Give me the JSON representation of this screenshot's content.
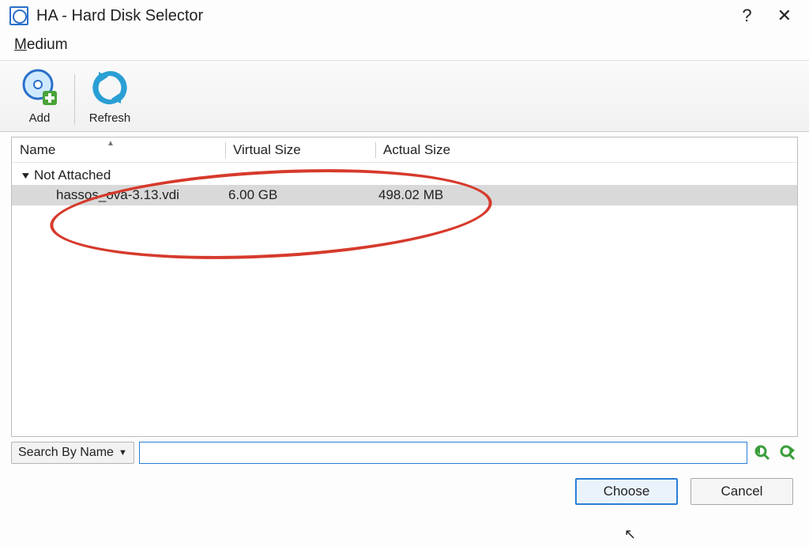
{
  "window": {
    "title": "HA - Hard Disk Selector"
  },
  "menu": {
    "medium": "Medium"
  },
  "toolbar": {
    "add_label": "Add",
    "refresh_label": "Refresh"
  },
  "columns": {
    "name": "Name",
    "virtual_size": "Virtual Size",
    "actual_size": "Actual Size"
  },
  "tree": {
    "group_label": "Not Attached",
    "items": [
      {
        "name": "hassos_ova-3.13.vdi",
        "virtual_size": "6.00 GB",
        "actual_size": "498.02 MB"
      }
    ]
  },
  "search": {
    "mode_label": "Search By Name",
    "value": "",
    "placeholder": ""
  },
  "buttons": {
    "choose": "Choose",
    "cancel": "Cancel"
  }
}
